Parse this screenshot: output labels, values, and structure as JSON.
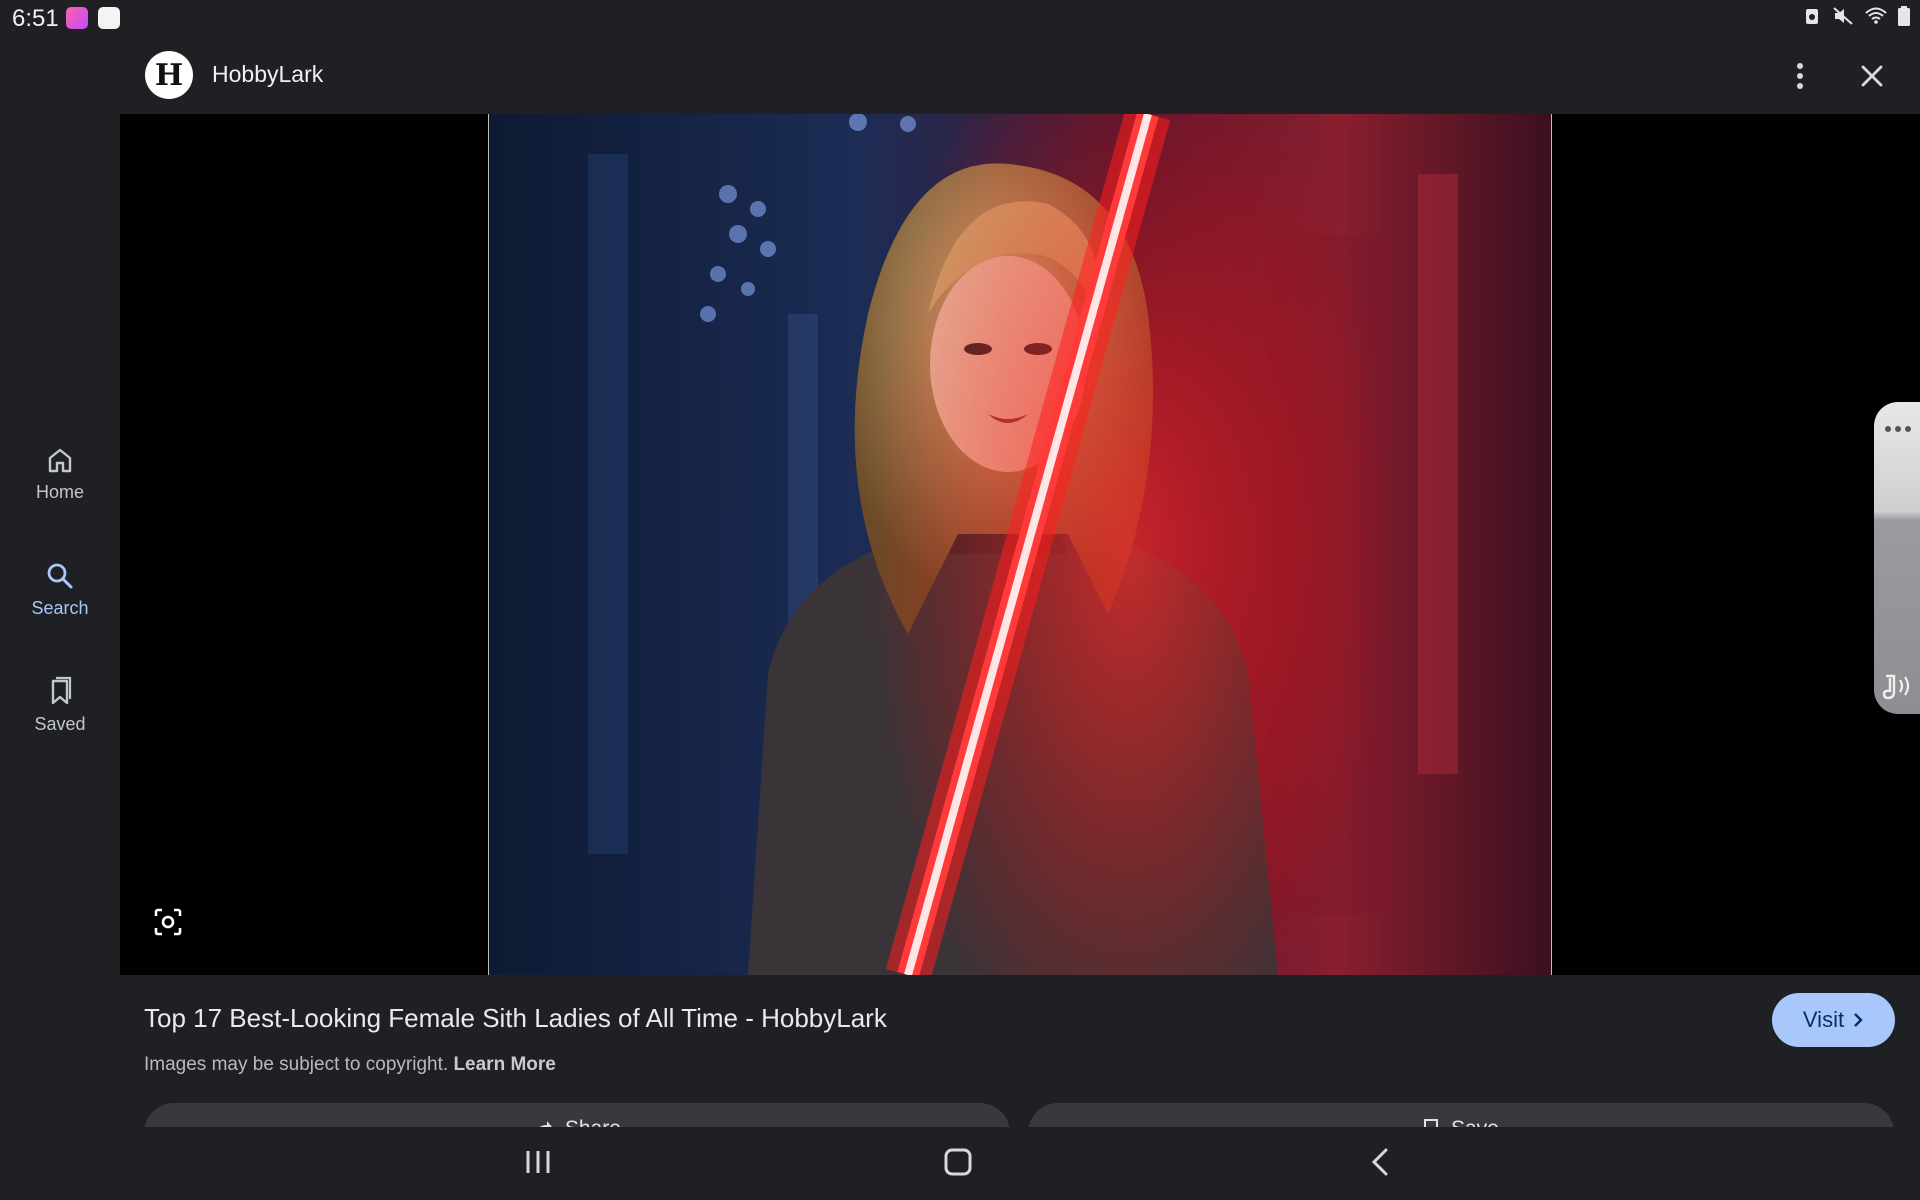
{
  "status_bar": {
    "time": "6:51"
  },
  "sidenav": {
    "items": [
      {
        "label": "Home",
        "icon": "home-icon"
      },
      {
        "label": "Search",
        "icon": "search-icon"
      },
      {
        "label": "Saved",
        "icon": "bookmark-icon"
      }
    ],
    "active": "Search"
  },
  "header": {
    "logo_letter": "H",
    "site_name": "HobbyLark"
  },
  "result": {
    "title": "Top 17 Best-Looking Female Sith Ladies of All Time - HobbyLark",
    "copyright_text": "Images may be subject to copyright.",
    "learn_more": "Learn More",
    "visit_label": "Visit",
    "share_label": "Share",
    "save_label": "Save"
  },
  "colors": {
    "background": "#1f2024",
    "accent": "#a8c7fa",
    "active_nav": "#a8c7fa"
  }
}
